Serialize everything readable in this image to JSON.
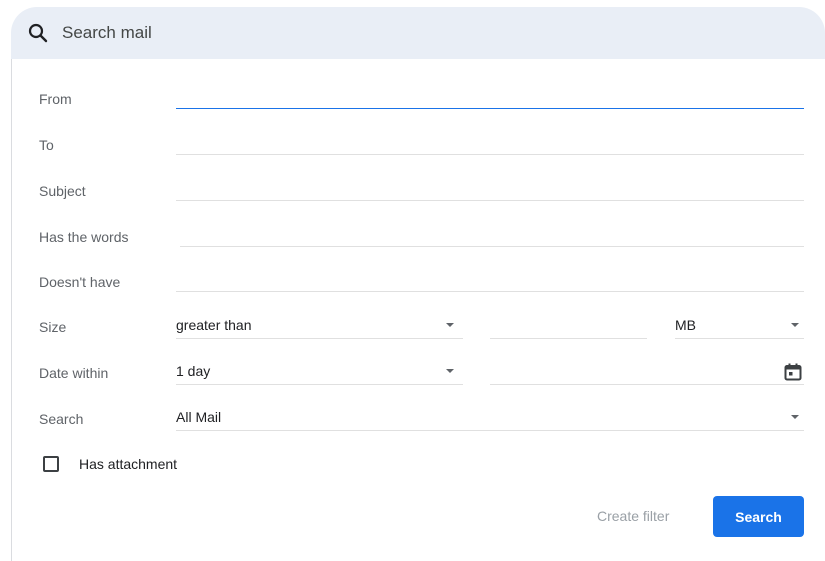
{
  "search": {
    "placeholder": "Search mail",
    "icon": "search-icon"
  },
  "form": {
    "from_label": "From",
    "to_label": "To",
    "subject_label": "Subject",
    "has_words_label": "Has the words",
    "doesnt_have_label": "Doesn't have",
    "size": {
      "label": "Size",
      "operator": "greater than",
      "value": "",
      "unit": "MB"
    },
    "date_within": {
      "label": "Date within",
      "value": "1 day",
      "date": ""
    },
    "search_in": {
      "label": "Search",
      "value": "All Mail"
    },
    "has_attachment": {
      "label": "Has attachment",
      "checked": false
    }
  },
  "actions": {
    "create_filter": "Create filter",
    "search": "Search"
  },
  "colors": {
    "accent": "#1a73e8",
    "search_bar_bg": "#e9eef6",
    "disabled_text": "#9aa0a6"
  }
}
